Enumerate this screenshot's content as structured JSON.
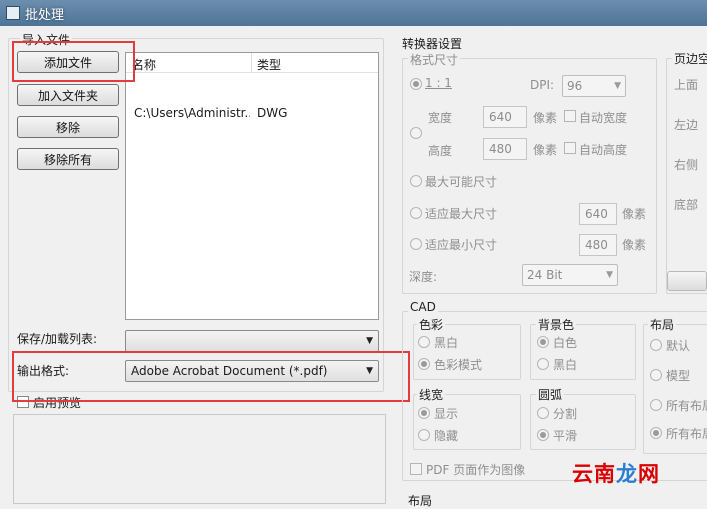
{
  "window": {
    "title": "批处理"
  },
  "import": {
    "group_label": "导入文件",
    "buttons": {
      "add_file": "添加文件",
      "add_folder": "加入文件夹",
      "remove": "移除",
      "remove_all": "移除所有"
    },
    "columns": [
      "名称",
      "类型"
    ],
    "rows": [
      {
        "name": "C:\\Users\\Administr...",
        "type": "DWG"
      }
    ],
    "save_load_label": "保存/加载列表:",
    "save_load_value": "",
    "output_label": "输出格式:",
    "output_value": "Adobe Acrobat Document (*.pdf)",
    "preview_label": "启用预览"
  },
  "converter": {
    "title": "转换器设置",
    "format_size": {
      "label": "格式尺寸",
      "ratio": "1 : 1",
      "dpi_label": "DPI:",
      "dpi_value": "96",
      "width_label": "宽度",
      "width_value": "640",
      "width_unit": "像素",
      "auto_width": "自动宽度",
      "height_label": "高度",
      "height_value": "480",
      "height_unit": "像素",
      "auto_height": "自动高度",
      "max_possible": "最大可能尺寸",
      "fit_max": "适应最大尺寸",
      "fit_max_value": "640",
      "fit_max_unit": "像素",
      "fit_min": "适应最小尺寸",
      "fit_min_value": "480",
      "fit_min_unit": "像素",
      "depth_label": "深度:",
      "depth_value": "24 Bit"
    },
    "margins": {
      "label": "页边空",
      "top": "上面",
      "left": "左边",
      "right": "右侧",
      "bottom": "底部"
    },
    "cad": {
      "label": "CAD",
      "color": {
        "label": "色彩",
        "options": [
          "黑白",
          "色彩模式"
        ],
        "selected": 1
      },
      "background": {
        "label": "背景色",
        "options": [
          "白色",
          "黑白"
        ],
        "selected": 0
      },
      "layout": {
        "label": "布局",
        "options": [
          "默认",
          "模型",
          "所有布局",
          "所有布局"
        ],
        "selected": 3
      },
      "line_width": {
        "label": "线宽",
        "options": [
          "显示",
          "隐藏"
        ],
        "selected": 0
      },
      "arc": {
        "label": "圆弧",
        "options": [
          "分割",
          "平滑"
        ],
        "selected": 1
      },
      "pdf_as_image": "PDF 页面作为图像"
    },
    "layout_label": "布局"
  },
  "watermark": {
    "text_a": "云南",
    "text_b": "龙",
    "text_c": "网"
  },
  "colors": {
    "title_bar": "#5a7ea2",
    "highlight": "#e23c3c",
    "panel": "#f0f0f0"
  }
}
